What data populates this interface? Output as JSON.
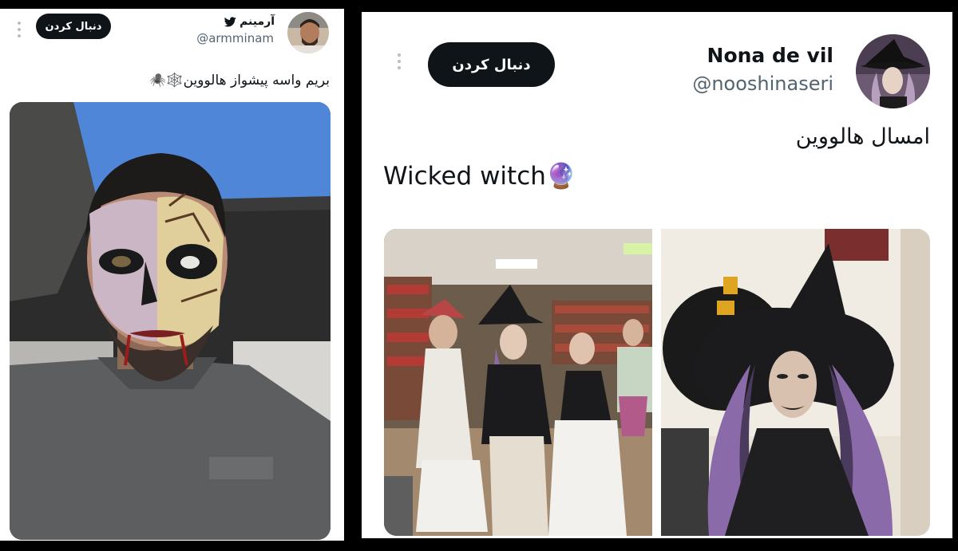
{
  "tweets": [
    {
      "display_name": "آرمینم",
      "handle": "@armminam",
      "follow_label": "دنبال کردن",
      "text": "بریم واسه پیشواز هالووین🕸️🕷️",
      "verified_icon": "bird-icon"
    },
    {
      "display_name": "Nona de vil",
      "handle": "@nooshinaseri",
      "follow_label": "دنبال کردن",
      "text_line1": "امسال هالووین",
      "text_line2": "Wicked witch🔮"
    }
  ],
  "colors": {
    "follow_bg": "#0f1419",
    "name": "#0f1419",
    "handle": "#536471",
    "dots": "#b9c0c6",
    "sky": "#4f86d8",
    "witch_hat": "#1b1b1d",
    "purple_hair": "#8a6aa8"
  }
}
